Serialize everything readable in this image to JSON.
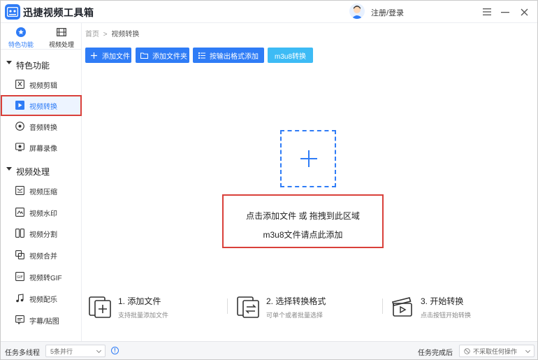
{
  "app": {
    "title": "迅捷视频工具箱"
  },
  "header": {
    "login_label": "注册/登录"
  },
  "sidebar": {
    "tabs": [
      {
        "label": "特色功能",
        "icon": "star-icon"
      },
      {
        "label": "视频处理",
        "icon": "film-icon"
      }
    ],
    "sections": [
      {
        "title": "特色功能",
        "items": [
          {
            "label": "视频剪辑",
            "icon": "scissors-icon"
          },
          {
            "label": "视频转换",
            "icon": "video-convert-icon"
          },
          {
            "label": "音频转换",
            "icon": "audio-icon"
          },
          {
            "label": "屏幕录像",
            "icon": "screen-record-icon"
          }
        ]
      },
      {
        "title": "视频处理",
        "items": [
          {
            "label": "视频压缩",
            "icon": "compress-icon"
          },
          {
            "label": "视频水印",
            "icon": "watermark-icon"
          },
          {
            "label": "视频分割",
            "icon": "split-icon"
          },
          {
            "label": "视频合并",
            "icon": "merge-icon"
          },
          {
            "label": "视频转GIF",
            "icon": "gif-icon"
          },
          {
            "label": "视频配乐",
            "icon": "music-icon"
          },
          {
            "label": "字幕/贴图",
            "icon": "subtitle-icon"
          }
        ]
      }
    ]
  },
  "breadcrumb": {
    "home": "首页",
    "separator": ">",
    "current": "视频转换"
  },
  "toolbar": {
    "add_file": "添加文件",
    "add_folder": "添加文件夹",
    "add_by_format": "按输出格式添加",
    "m3u8": "m3u8转换"
  },
  "dropzone": {
    "line1": "点击添加文件 或 拖拽到此区域",
    "line2": "m3u8文件请点此添加"
  },
  "steps": [
    {
      "title": "1. 添加文件",
      "desc": "支持批量添加文件"
    },
    {
      "title": "2. 选择转换格式",
      "desc": "可单个或者批量选择"
    },
    {
      "title": "3. 开始转换",
      "desc": "点击按钮开始转换"
    }
  ],
  "statusbar": {
    "threads_label": "任务多线程",
    "threads_value": "5条并行",
    "after_label": "任务完成后",
    "after_value": "不采取任何操作"
  },
  "colors": {
    "accent": "#2f7cf6",
    "accent_light": "#3dbbf5",
    "highlight": "#d9403a"
  }
}
